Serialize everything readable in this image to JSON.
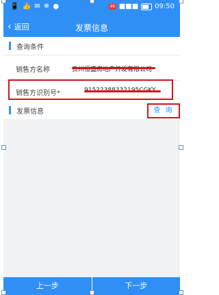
{
  "status": {
    "left": "📱 👍 ✉ ❄ ●",
    "signal": "■■■",
    "time": "09:50"
  },
  "nav": {
    "back_label": "返回",
    "title": "发票信息"
  },
  "query_section": {
    "title": "查询条件",
    "seller_name_label": "销售方名称",
    "seller_name_value": "贵州恒盛房地产开发有限公司",
    "seller_id_label": "销售方识别号*",
    "seller_id_value": "91522388332195CGKY"
  },
  "invoice_section": {
    "title": "发票信息",
    "query_button": "查 询"
  },
  "footer": {
    "prev": "上一步",
    "next": "下一步"
  },
  "colors": {
    "primary": "#2f8ff5",
    "highlight_red": "#d8121a",
    "background": "#f1f2f5"
  }
}
